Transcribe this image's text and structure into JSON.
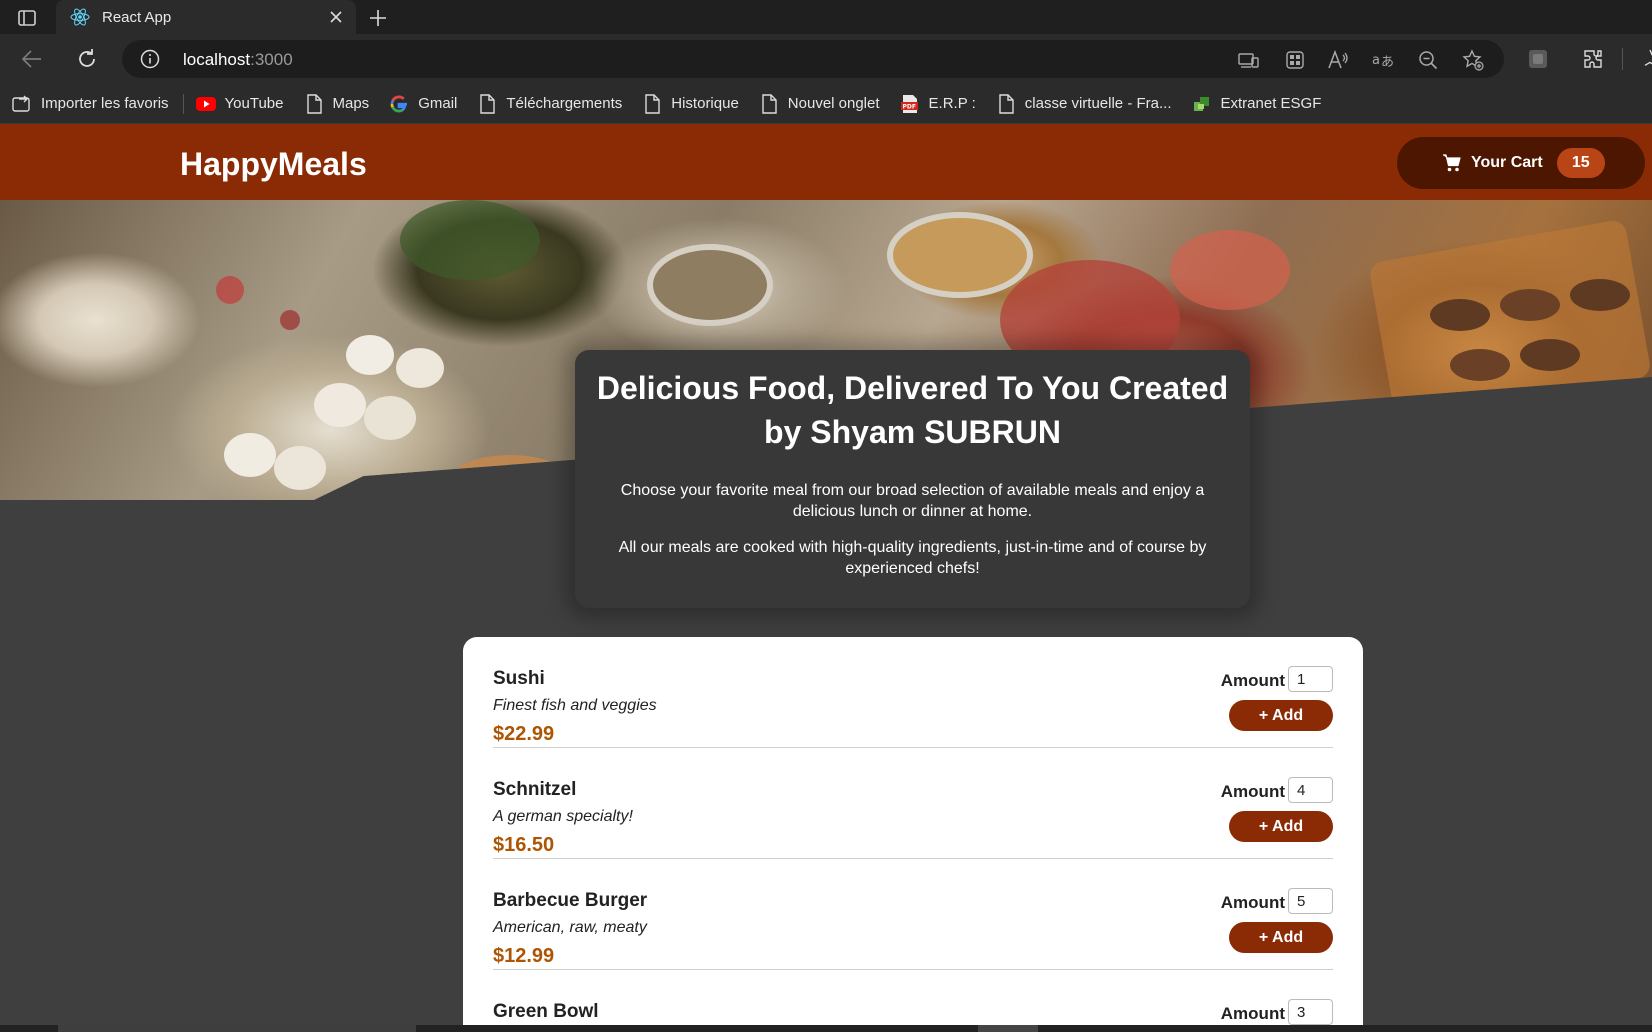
{
  "browser": {
    "tab_title": "React App",
    "url_host": "localhost",
    "url_port": ":3000",
    "bookmarks": [
      {
        "label": "Importer les favoris",
        "icon": "import-icon"
      },
      {
        "label": "YouTube",
        "icon": "youtube-icon"
      },
      {
        "label": "Maps",
        "icon": "page-icon"
      },
      {
        "label": "Gmail",
        "icon": "google-icon"
      },
      {
        "label": "Téléchargements",
        "icon": "page-icon"
      },
      {
        "label": "Historique",
        "icon": "page-icon"
      },
      {
        "label": "Nouvel onglet",
        "icon": "page-icon"
      },
      {
        "label": "E.R.P :",
        "icon": "pdf-icon"
      },
      {
        "label": "classe virtuelle - Fra...",
        "icon": "page-icon"
      },
      {
        "label": "Extranet ESGF",
        "icon": "extranet-icon"
      }
    ]
  },
  "header": {
    "logo": "HappyMeals",
    "cart_label": "Your Cart",
    "cart_count": "15"
  },
  "summary": {
    "title": "Delicious Food, Delivered To You Created by Shyam SUBRUN",
    "paragraph1": "Choose your favorite meal from our broad selection of available meals and enjoy a delicious lunch or dinner at home.",
    "paragraph2": "All our meals are cooked with high-quality ingredients, just-in-time and of course by experienced chefs!"
  },
  "meals": [
    {
      "name": "Sushi",
      "description": "Finest fish and veggies",
      "price": "$22.99",
      "amount": "1"
    },
    {
      "name": "Schnitzel",
      "description": "A german specialty!",
      "price": "$16.50",
      "amount": "4"
    },
    {
      "name": "Barbecue Burger",
      "description": "American, raw, meaty",
      "price": "$12.99",
      "amount": "5"
    },
    {
      "name": "Green Bowl",
      "description": "",
      "price": "",
      "amount": "3"
    }
  ],
  "labels": {
    "amount": "Amount",
    "add": "+ Add"
  },
  "colors": {
    "header_bg": "#8a2b06",
    "cart_bg": "#4d1601",
    "badge_bg": "#b94517",
    "price": "#ad5502",
    "page_bg": "#3f3f3f"
  }
}
